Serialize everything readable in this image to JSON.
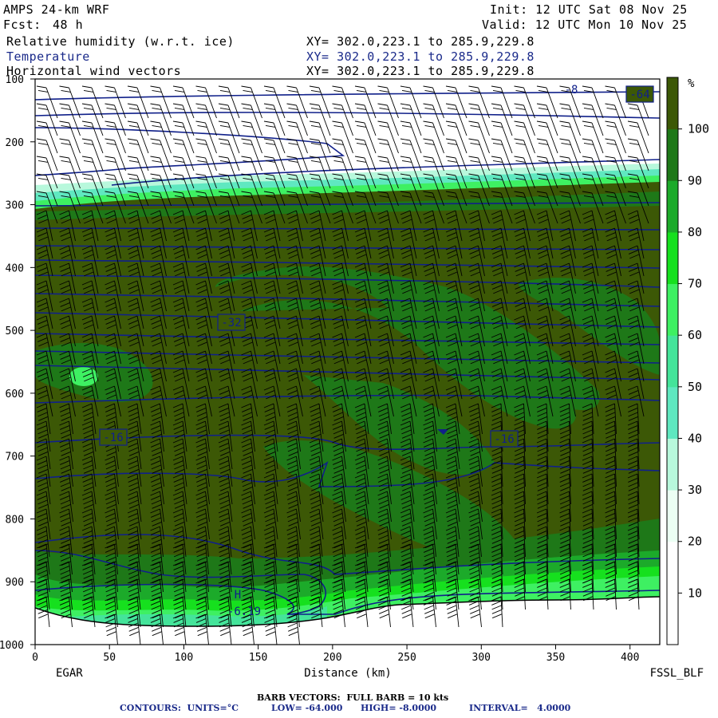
{
  "header": {
    "model": "AMPS 24-km WRF",
    "fcst_label": "Fcst:",
    "fcst_value": "48 h",
    "init": "Init: 12 UTC Sat 08 Nov 25",
    "valid": "Valid: 12 UTC Mon 10 Nov 25",
    "fields": [
      {
        "name": "Relative humidity (w.r.t. ice)",
        "xy": "XY= 302.0,223.1 to 285.9,229.8",
        "color": "#000000"
      },
      {
        "name": "Temperature",
        "xy": "XY= 302.0,223.1 to 285.9,229.8",
        "color": "#1a2a8a"
      },
      {
        "name": "Horizontal wind vectors",
        "xy": "XY= 302.0,223.1 to 285.9,229.8",
        "color": "#000000"
      }
    ]
  },
  "chart_data": {
    "type": "heatmap",
    "xlabel": "Distance (km)",
    "ylabel": "",
    "x_ticks": [
      0,
      50,
      100,
      150,
      200,
      250,
      300,
      350,
      400
    ],
    "y_ticks": [
      100,
      200,
      300,
      400,
      500,
      600,
      700,
      800,
      900,
      1000
    ],
    "xlim": [
      0,
      420
    ],
    "ylim": [
      1000,
      100
    ],
    "left_label": "EGAR",
    "right_label": "FSSL_BLF",
    "colorbar": {
      "unit": "%",
      "ticks": [
        10,
        20,
        30,
        40,
        50,
        60,
        70,
        80,
        90,
        100
      ],
      "colors": [
        "#ffffff",
        "#ffffff",
        "#ecfff4",
        "#b8f8dc",
        "#5fe8c0",
        "#44e49a",
        "#3ef062",
        "#16e01e",
        "#1caa2a",
        "#1e7818",
        "#3c5806"
      ]
    },
    "contour_labels": [
      "-32",
      "-16",
      "-16",
      "-64",
      "-8",
      "H",
      "-6.19"
    ],
    "footer": {
      "barb": "BARB VECTORS:  FULL BARB = 10 kts",
      "contours_units": "CONTOURS:  UNITS=°C",
      "low": "LOW= -64.000",
      "high": "HIGH= -8.0000",
      "interval": "INTERVAL=   4.0000"
    }
  }
}
